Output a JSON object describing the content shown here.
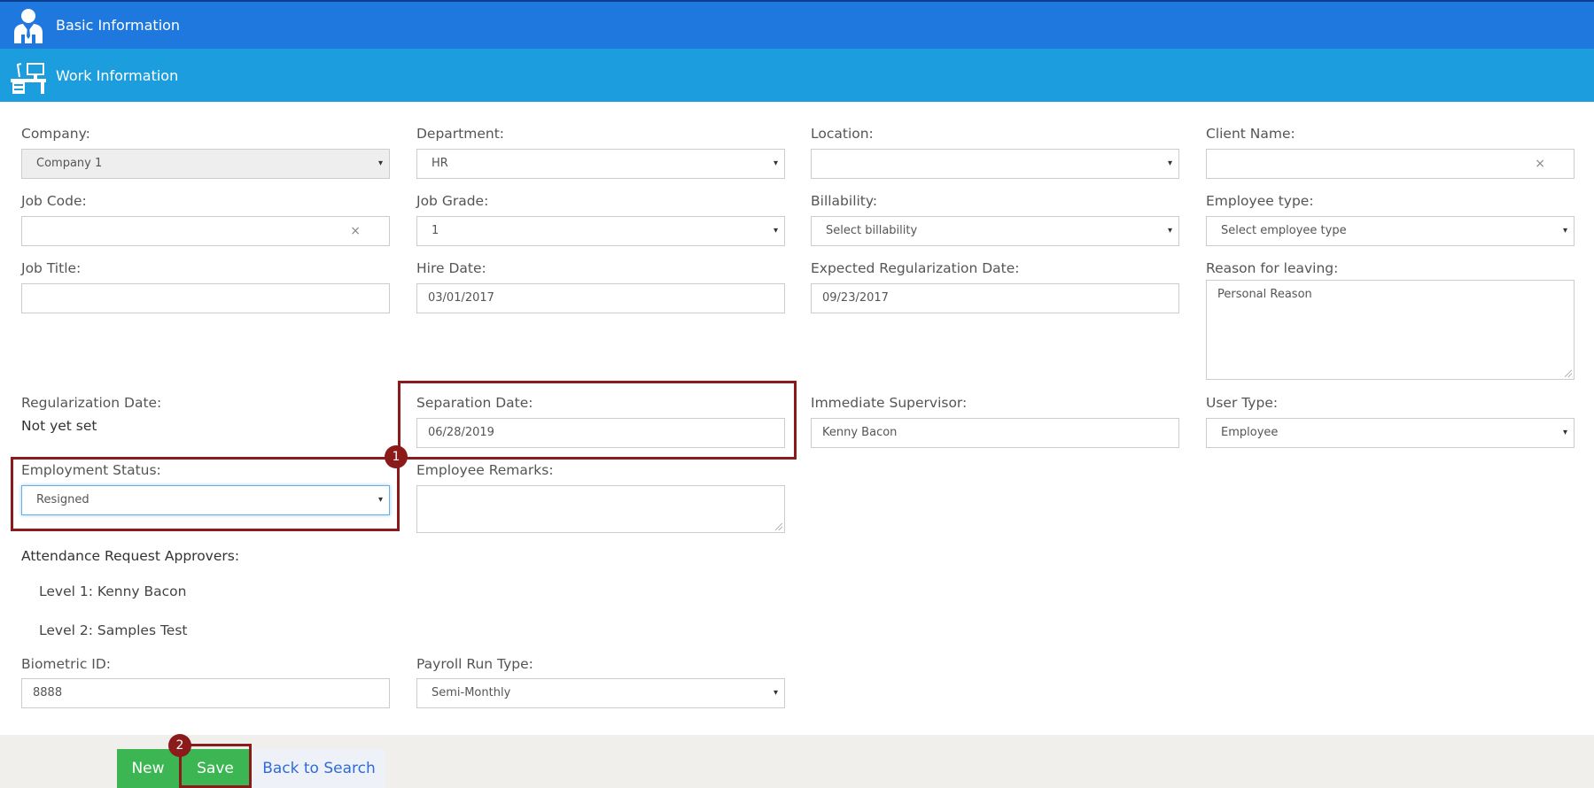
{
  "sections": {
    "basic": {
      "title": "Basic Information"
    },
    "work": {
      "title": "Work Information"
    }
  },
  "form": {
    "company": {
      "label": "Company:",
      "value": "Company 1"
    },
    "department": {
      "label": "Department:",
      "value": "HR"
    },
    "location": {
      "label": "Location:",
      "value": ""
    },
    "client_name": {
      "label": "Client Name:",
      "value": ""
    },
    "job_code": {
      "label": "Job Code:",
      "value": ""
    },
    "job_grade": {
      "label": "Job Grade:",
      "value": "1"
    },
    "billability": {
      "label": "Billability:",
      "value": "Select billability"
    },
    "employee_type": {
      "label": "Employee type:",
      "value": "Select employee type"
    },
    "job_title": {
      "label": "Job Title:",
      "value": ""
    },
    "hire_date": {
      "label": "Hire Date:",
      "value": "03/01/2017"
    },
    "expected_regularization_date": {
      "label": "Expected Regularization Date:",
      "value": "09/23/2017"
    },
    "reason_for_leaving": {
      "label": "Reason for leaving:",
      "value": "Personal Reason"
    },
    "regularization_date": {
      "label": "Regularization Date:",
      "value": "Not yet set"
    },
    "separation_date": {
      "label": "Separation Date:",
      "value": "06/28/2019"
    },
    "immediate_supervisor": {
      "label": "Immediate Supervisor:",
      "value": "Kenny Bacon"
    },
    "user_type": {
      "label": "User Type:",
      "value": "Employee"
    },
    "employment_status": {
      "label": "Employment Status:",
      "value": "Resigned"
    },
    "employee_remarks": {
      "label": "Employee Remarks:",
      "value": ""
    },
    "attendance_approvers": {
      "label": "Attendance Request Approvers:",
      "levels": [
        "Level 1: Kenny Bacon",
        "Level 2: Samples Test"
      ]
    },
    "biometric_id": {
      "label": "Biometric ID:",
      "value": "8888"
    },
    "payroll_run_type": {
      "label": "Payroll Run Type:",
      "value": "Semi-Monthly"
    }
  },
  "icons": {
    "caret": "▾",
    "clear": "×"
  },
  "annotations": {
    "badge1": "1",
    "badge2": "2"
  },
  "buttons": {
    "new": "New",
    "save": "Save",
    "back": "Back to Search"
  },
  "colors": {
    "basic_header": "#1f78dd",
    "work_header": "#1c9ddd",
    "highlight": "#8b1a1a",
    "button_green": "#3cb653",
    "link": "#2f6bd8"
  }
}
